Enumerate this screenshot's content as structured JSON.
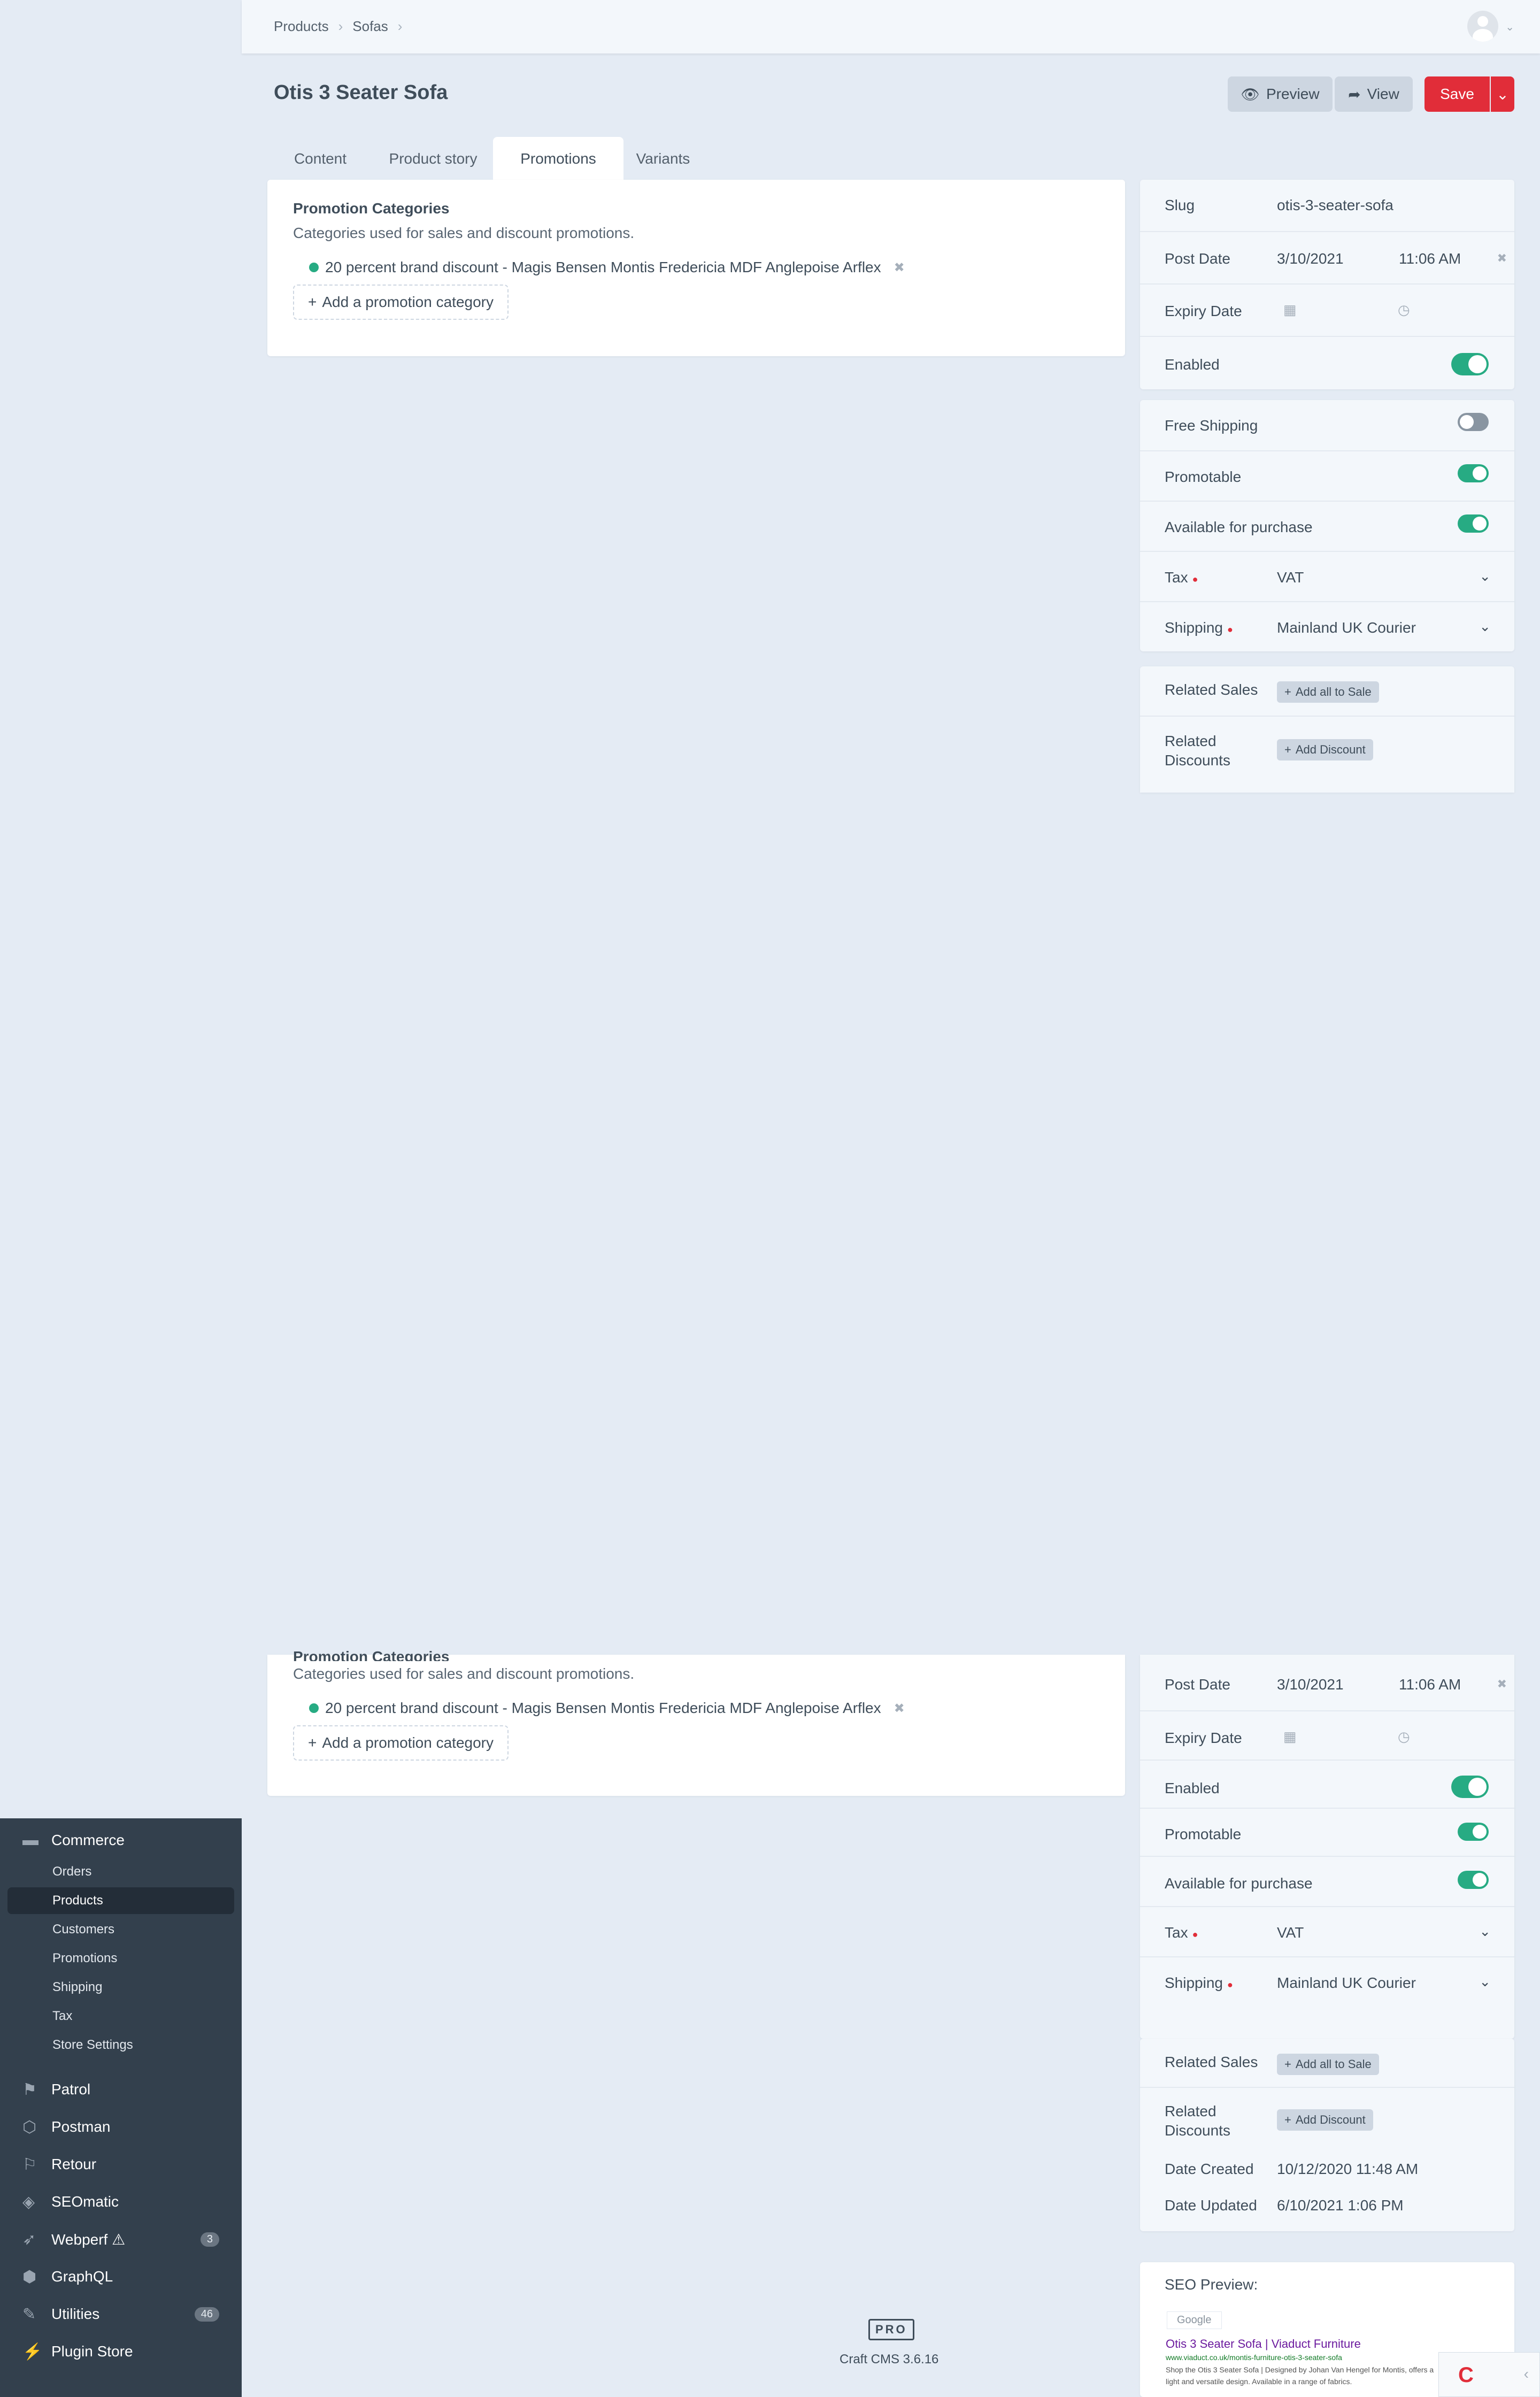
{
  "breadcrumbs": [
    "Products",
    "Sofas"
  ],
  "page": {
    "title": "Otis 3 Seater Sofa",
    "preview_label": "Preview",
    "view_label": "View",
    "save_label": "Save"
  },
  "tabs": [
    "Content",
    "Product story",
    "Promotions",
    "Variants"
  ],
  "active_tab": "Promotions",
  "promotions": {
    "title": "Promotion Categories",
    "description": "Categories used for sales and discount promotions.",
    "item": "20 percent brand discount - Magis Bensen Montis Fredericia MDF Anglepoise Arflex",
    "add_label": "Add a promotion category"
  },
  "meta": {
    "slug_label": "Slug",
    "slug_value": "otis-3-seater-sofa",
    "post_date_label": "Post Date",
    "post_date": "3/10/2021",
    "post_time": "11:06 AM",
    "expiry_label": "Expiry Date",
    "enabled_label": "Enabled",
    "enabled": true
  },
  "commerce": {
    "free_shipping_label": "Free Shipping",
    "free_shipping": false,
    "promotable_label": "Promotable",
    "promotable": true,
    "available_label": "Available for purchase",
    "available": true,
    "tax_label": "Tax",
    "tax_value": "VAT",
    "shipping_label": "Shipping",
    "shipping_value": "Mainland UK Courier"
  },
  "related": {
    "sales_label": "Related Sales",
    "sales_button": "Add all to Sale",
    "discounts_label_1": "Related",
    "discounts_label_2": "Discounts",
    "discounts_button": "Add Discount",
    "date_created_label": "Date Created",
    "date_created": "10/12/2020 11:48 AM",
    "date_updated_label": "Date Updated",
    "date_updated": "6/10/2021 1:06 PM"
  },
  "seo": {
    "label": "SEO Preview:",
    "engine": "Google",
    "title": "Otis 3 Seater Sofa | Viaduct Furniture",
    "url": "www.viaduct.co.uk/montis-furniture-otis-3-seater-sofa",
    "description": "Shop the Otis 3 Seater Sofa | Designed by Johan Van Hengel for Montis, offers a light and versatile design. Available in a range of fabrics."
  },
  "sidebar": {
    "commerce_label": "Commerce",
    "sub_items": [
      "Orders",
      "Products",
      "Customers",
      "Promotions",
      "Shipping",
      "Tax",
      "Store Settings"
    ],
    "active_sub": "Products",
    "plugins": [
      {
        "label": "Patrol",
        "icon": "flag-icon"
      },
      {
        "label": "Postman",
        "icon": "cube-icon"
      },
      {
        "label": "Retour",
        "icon": "signpost-icon"
      },
      {
        "label": "SEOmatic",
        "icon": "tag-icon"
      },
      {
        "label": "Webperf ⚠",
        "icon": "rocket-icon",
        "badge": "3"
      },
      {
        "label": "GraphQL",
        "icon": "graphql-icon"
      },
      {
        "label": "Utilities",
        "icon": "wrench-icon",
        "badge": "46"
      },
      {
        "label": "Plugin Store",
        "icon": "plug-icon"
      }
    ]
  },
  "footer": {
    "edition": "PRO",
    "version": "Craft CMS 3.6.16"
  },
  "colors": {
    "accent_red": "#e12d39",
    "toggle_green": "#27ab83",
    "sidebar_bg": "#33404d",
    "page_bg": "#e4ebf4"
  }
}
